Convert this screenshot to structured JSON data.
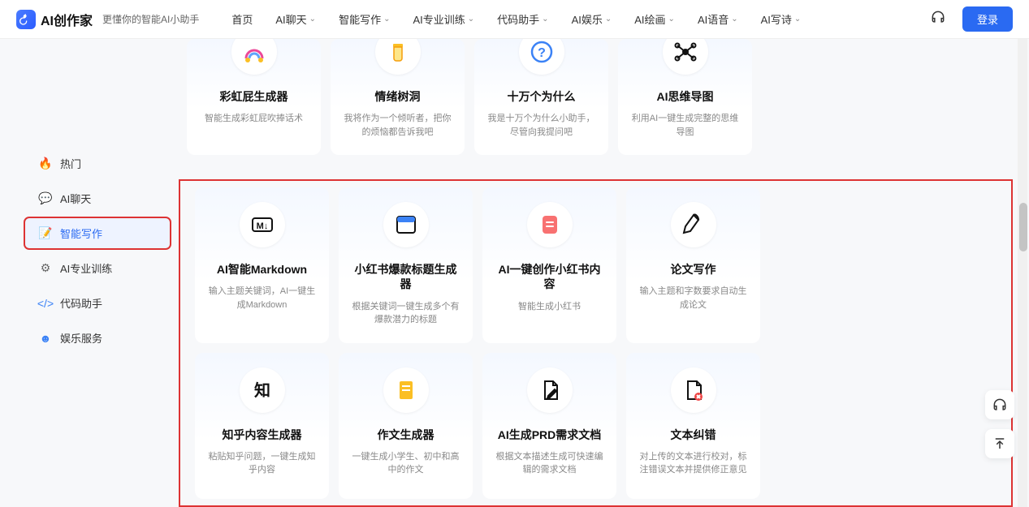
{
  "header": {
    "logo_text": "AI创作家",
    "logo_sub": "更懂你的智能AI小助手",
    "nav": [
      "首页",
      "AI聊天",
      "智能写作",
      "AI专业训练",
      "代码助手",
      "AI娱乐",
      "AI绘画",
      "AI语音",
      "AI写诗"
    ],
    "nav_has_dropdown": [
      false,
      true,
      true,
      true,
      true,
      true,
      true,
      true,
      true
    ],
    "login": "登录"
  },
  "sidebar": {
    "items": [
      {
        "label": "热门",
        "icon": "🔥",
        "color": "#3b82f6"
      },
      {
        "label": "AI聊天",
        "icon": "💬",
        "color": "#3b82f6"
      },
      {
        "label": "智能写作",
        "icon": "📝",
        "color": "#2a6af2",
        "active": true
      },
      {
        "label": "AI专业训练",
        "icon": "⚙",
        "color": "#666"
      },
      {
        "label": "代码助手",
        "icon": "</>",
        "color": "#3b82f6"
      },
      {
        "label": "娱乐服务",
        "icon": "☻",
        "color": "#3b82f6"
      }
    ]
  },
  "top_cards": [
    {
      "title": "彩虹屁生成器",
      "desc": "智能生成彩虹屁吹捧话术",
      "icon": "rainbow"
    },
    {
      "title": "情绪树洞",
      "desc": "我将作为一个倾听者，把你的烦恼都告诉我吧",
      "icon": "jar"
    },
    {
      "title": "十万个为什么",
      "desc": "我是十万个为什么小助手，尽管向我提问吧",
      "icon": "question"
    },
    {
      "title": "AI思维导图",
      "desc": "利用AI一键生成完整的思维导图",
      "icon": "mindmap"
    }
  ],
  "main_cards": [
    {
      "title": "AI智能Markdown",
      "desc": "输入主题关键词，AI一键生成Markdown",
      "icon": "markdown"
    },
    {
      "title": "小红书爆款标题生成器",
      "desc": "根据关键词一键生成多个有爆款潜力的标题",
      "icon": "window"
    },
    {
      "title": "AI一键创作小红书内容",
      "desc": "智能生成小红书",
      "icon": "note"
    },
    {
      "title": "论文写作",
      "desc": "输入主题和字数要求自动生成论文",
      "icon": "pen"
    },
    {
      "title": "知乎内容生成器",
      "desc": "粘贴知乎问题，一键生成知乎内容",
      "icon": "zhi"
    },
    {
      "title": "作文生成器",
      "desc": "一键生成小学生、初中和高中的作文",
      "icon": "doc"
    },
    {
      "title": "AI生成PRD需求文档",
      "desc": "根据文本描述生成可快速编辑的需求文档",
      "icon": "docedit"
    },
    {
      "title": "文本纠错",
      "desc": "对上传的文本进行校对，标注错误文本并提供修正意见",
      "icon": "docerr"
    }
  ]
}
